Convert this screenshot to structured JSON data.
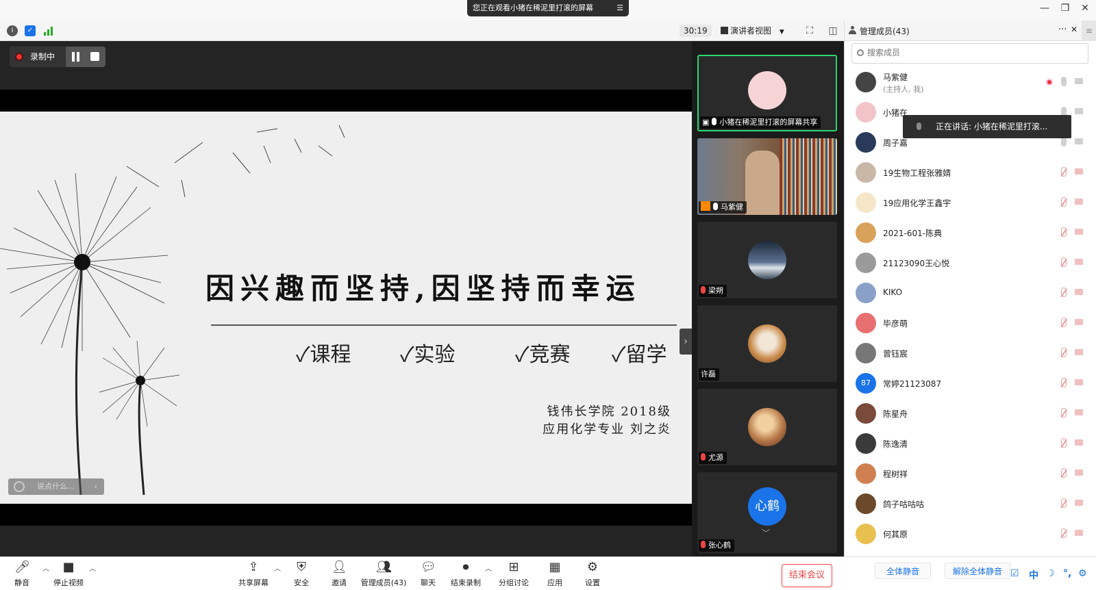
{
  "window": {
    "share_banner": "您正在观看小猪在稀泥里打滚的屏幕",
    "share_menu_icon": "list-icon",
    "controls": [
      "—",
      "❐",
      "✕"
    ]
  },
  "toolbar": {
    "info_icon": "info-icon",
    "shield_icon": "shield-icon",
    "signal_icon": "signal-icon",
    "timer": "30:19",
    "view_mode": "演讲者视图",
    "fullscreen_icon": "fullscreen-icon",
    "panel_icon": "sidebar-icon"
  },
  "recording": {
    "label": "录制中"
  },
  "slide": {
    "title": "因兴趣而坚持,因坚持而幸运",
    "checks": [
      "✓课程",
      "✓实验",
      "✓竞赛",
      "✓留学"
    ],
    "author_line1": "钱伟长学院  2018级",
    "author_line2": "应用化学专业  刘之炎"
  },
  "chat": {
    "placeholder": "说点什么..."
  },
  "thumbnails": [
    {
      "label": "小猪在稀泥里打滚的屏幕共享",
      "mic": "on",
      "active": true,
      "avatar": "pink-pig"
    },
    {
      "label": "马紫健",
      "mic": "on",
      "active": false,
      "avatar": "video"
    },
    {
      "label": "梁朔",
      "mic": "off",
      "active": false,
      "avatar": "landscape"
    },
    {
      "label": "许磊",
      "mic": "none",
      "active": false,
      "avatar": "dog"
    },
    {
      "label": "尤源",
      "mic": "off",
      "active": false,
      "avatar": "anime"
    },
    {
      "label": "张心鹤",
      "mic": "off",
      "active": false,
      "avatar_text": "心鹤"
    }
  ],
  "panel": {
    "title": "管理成员(43)",
    "more": "···",
    "close": "✕",
    "search_placeholder": "搜索成员",
    "speaking_tip": "正在讲话: 小猪在稀泥里打滚...",
    "members": [
      {
        "name": "马紫健",
        "sub": "(主持人, 我)",
        "recording": true,
        "mic": "on"
      },
      {
        "name": "小猪在",
        "sub": "",
        "mic": "on"
      },
      {
        "name": "周子嘉",
        "sub": "",
        "mic": "on"
      },
      {
        "name": "19生物工程张雅婧",
        "sub": "",
        "mic": "off"
      },
      {
        "name": "19应用化学王鑫宇",
        "sub": "",
        "mic": "off"
      },
      {
        "name": "2021-601-陈典",
        "sub": "",
        "mic": "off"
      },
      {
        "name": "21123090王心悦",
        "sub": "",
        "mic": "off"
      },
      {
        "name": "KIKO",
        "sub": "",
        "mic": "off"
      },
      {
        "name": "毕彦萌",
        "sub": "",
        "mic": "off"
      },
      {
        "name": "曾钰宸",
        "sub": "",
        "mic": "off"
      },
      {
        "name": "常婷21123087",
        "sub": "",
        "mic": "off",
        "avatar_text": "87"
      },
      {
        "name": "陈星舟",
        "sub": "",
        "mic": "off"
      },
      {
        "name": "陈逸清",
        "sub": "",
        "mic": "off"
      },
      {
        "name": "程树祥",
        "sub": "",
        "mic": "off"
      },
      {
        "name": "鸽子咕咕咕",
        "sub": "",
        "mic": "off"
      },
      {
        "name": "何其原",
        "sub": "",
        "mic": "off"
      }
    ],
    "mute_all": "全体静音",
    "unmute_all": "解除全体静音"
  },
  "bottombar": {
    "items": [
      {
        "label": "静音",
        "icon": "microphone-icon"
      },
      {
        "label": "停止视频",
        "icon": "camera-icon"
      },
      {
        "label": "共享屏幕",
        "icon": "share-screen-icon"
      },
      {
        "label": "安全",
        "icon": "shield-icon"
      },
      {
        "label": "邀请",
        "icon": "add-user-icon"
      },
      {
        "label": "管理成员(43)",
        "icon": "members-icon"
      },
      {
        "label": "聊天",
        "icon": "chat-icon"
      },
      {
        "label": "结束录制",
        "icon": "stop-record-icon"
      },
      {
        "label": "分组讨论",
        "icon": "breakout-icon"
      },
      {
        "label": "应用",
        "icon": "apps-icon"
      },
      {
        "label": "设置",
        "icon": "gear-icon"
      }
    ],
    "end_meeting": "结束会议",
    "ime": [
      "中",
      "☽",
      "°,",
      "⚙"
    ]
  },
  "colors": {
    "accent": "#1a73e8",
    "active_border": "#2bd56f",
    "record_red": "#e33333",
    "end_red": "#e44444"
  }
}
